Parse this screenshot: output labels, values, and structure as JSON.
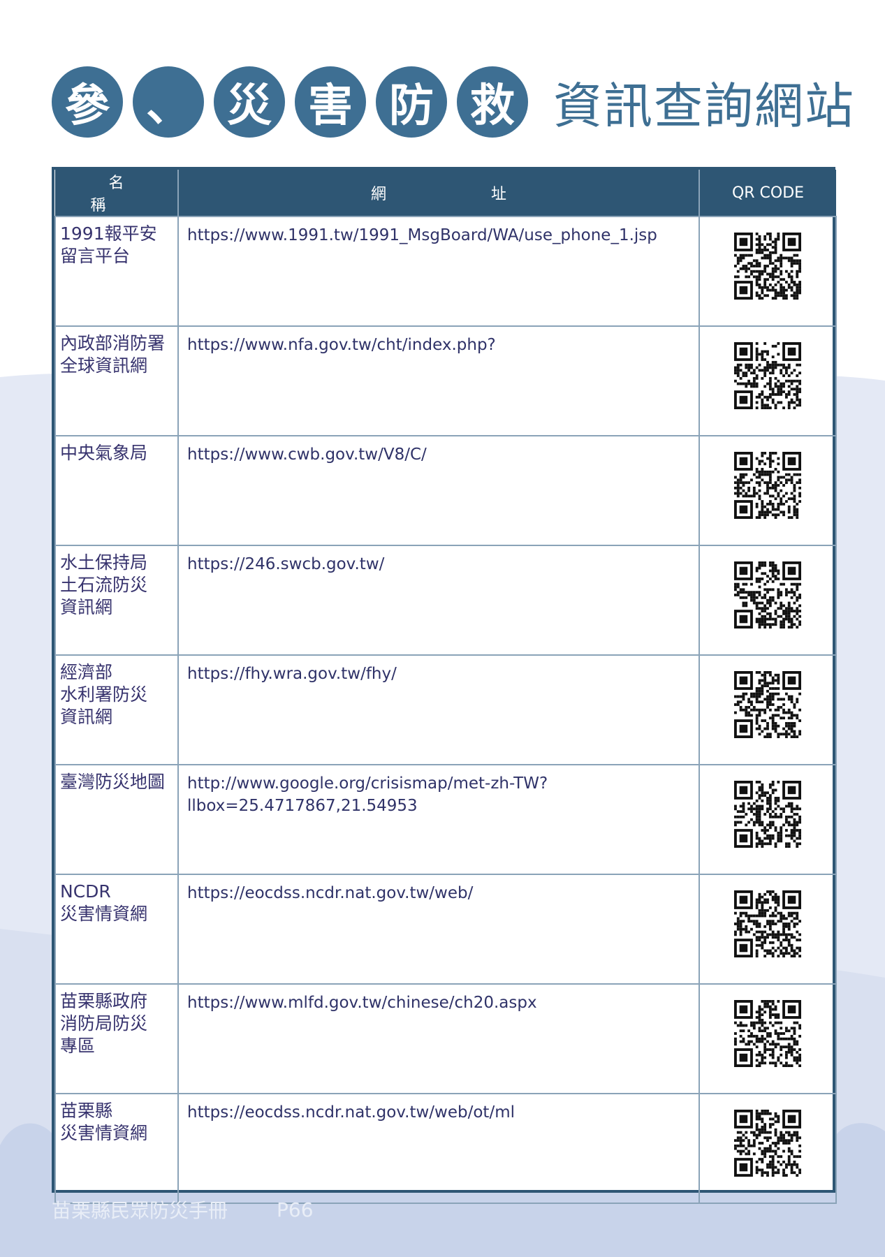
{
  "title": {
    "circles": [
      "參",
      "、",
      "災",
      "害",
      "防",
      "救"
    ],
    "subtitle": "資訊查詢網站"
  },
  "table": {
    "headers": {
      "name": "名稱",
      "url": "網址",
      "qr": "QR CODE"
    },
    "rows": [
      {
        "name": "1991報平安\n留言平台",
        "url": "https://www.1991.tw/1991_MsgBoard/WA/use_phone_1.jsp",
        "qr_icon": "qr-code-icon"
      },
      {
        "name": "內政部消防署\n全球資訊網",
        "url": "https://www.nfa.gov.tw/cht/index.php?",
        "qr_icon": "qr-code-icon"
      },
      {
        "name": "中央氣象局",
        "url": "https://www.cwb.gov.tw/V8/C/",
        "qr_icon": "qr-code-icon"
      },
      {
        "name": "水土保持局\n土石流防災\n資訊網",
        "url": "https://246.swcb.gov.tw/",
        "qr_icon": "qr-code-icon"
      },
      {
        "name": "經濟部\n水利署防災\n資訊網",
        "url": "https://fhy.wra.gov.tw/fhy/",
        "qr_icon": "qr-code-icon"
      },
      {
        "name": "臺灣防災地圖",
        "url": "http://www.google.org/crisismap/met-zh-TW?\nllbox=25.4717867,21.54953",
        "qr_icon": "qr-code-icon"
      },
      {
        "name": "NCDR\n災害情資網",
        "url": "https://eocdss.ncdr.nat.gov.tw/web/",
        "qr_icon": "qr-code-icon"
      },
      {
        "name": "苗栗縣政府\n消防局防災\n專區",
        "url": "https://www.mlfd.gov.tw/chinese/ch20.aspx",
        "qr_icon": "qr-code-icon"
      },
      {
        "name": "苗栗縣\n災害情資網",
        "url": "https://eocdss.ncdr.nat.gov.tw/web/ot/ml",
        "qr_icon": "qr-code-icon"
      }
    ]
  },
  "footer": {
    "title": "苗栗縣民眾防災手冊",
    "page": "P66"
  },
  "colors": {
    "accent": "#3e6f93",
    "header_bg": "#2e5674",
    "cloud_bg": "#c8d3ea",
    "text": "#37336e"
  }
}
